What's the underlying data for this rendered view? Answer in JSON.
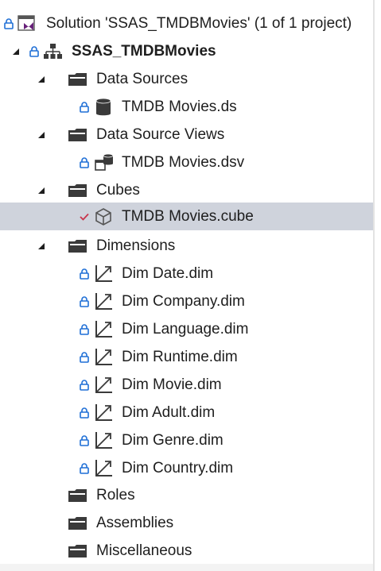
{
  "solution": {
    "label": "Solution 'SSAS_TMDBMovies' (1 of 1 project)",
    "icon": "visual-studio-solution-icon"
  },
  "project": {
    "label": "SSAS_TMDBMovies",
    "icon": "project-hierarchy-icon"
  },
  "folders": {
    "data_sources": {
      "label": "Data Sources",
      "items": [
        {
          "label": "TMDB Movies.ds",
          "icon": "database-icon"
        }
      ]
    },
    "data_source_views": {
      "label": "Data Source Views",
      "items": [
        {
          "label": "TMDB Movies.dsv",
          "icon": "data-source-view-icon"
        }
      ]
    },
    "cubes": {
      "label": "Cubes",
      "items": [
        {
          "label": "TMDB Movies.cube",
          "icon": "cube-icon"
        }
      ]
    },
    "dimensions": {
      "label": "Dimensions",
      "items": [
        {
          "label": "Dim Date.dim"
        },
        {
          "label": "Dim Company.dim"
        },
        {
          "label": "Dim Language.dim"
        },
        {
          "label": "Dim Runtime.dim"
        },
        {
          "label": "Dim Movie.dim"
        },
        {
          "label": "Dim Adult.dim"
        },
        {
          "label": "Dim Genre.dim"
        },
        {
          "label": "Dim Country.dim"
        }
      ]
    },
    "roles": {
      "label": "Roles"
    },
    "assemblies": {
      "label": "Assemblies"
    },
    "miscellaneous": {
      "label": "Miscellaneous"
    }
  },
  "colors": {
    "selection": "#cfd3dc",
    "lock": "#1f6fd6",
    "check": "#c8334a",
    "folder": "#3a3a3a",
    "vs_purple": "#68217a",
    "text": "#1e1e1e"
  }
}
